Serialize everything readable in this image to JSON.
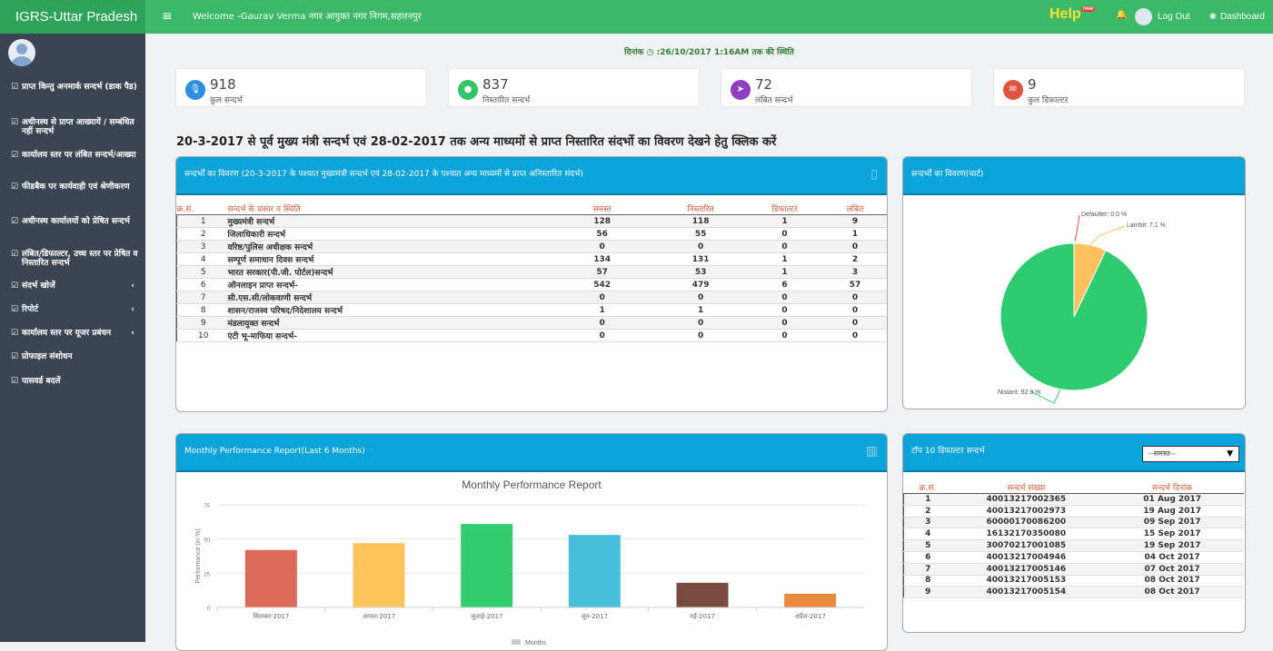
{
  "brand": "IGRS-Uttar Pradesh",
  "header": {
    "menu_icon": "≡",
    "welcome": "Welcome -Gaurav Verma नगर आयुक्त नगर निगम,सहारनपुर",
    "help": "Help",
    "help_badge": "new",
    "logout": "Log Out",
    "dashboard": "Dashboard",
    "icons": {
      "bell": "bell-icon",
      "user": "user-avatar-icon",
      "dashboard": "dashboard-icon"
    }
  },
  "sidebar": {
    "items": [
      {
        "label": "प्राप्त किन्तु अनमार्क सन्दर्भ (डाक पैड)",
        "arrow": ""
      },
      {
        "label": "अधीनस्थ से प्राप्त आख्यायें / सम्बंधित नहीं सन्दर्भ",
        "arrow": "‹"
      },
      {
        "label": "कार्यालय स्तर पर लंबित सन्दर्भ/आख्या",
        "arrow": ""
      },
      {
        "label": "फीडबैक पर कार्यवाही एवं श्रेणीकरण",
        "arrow": ""
      },
      {
        "label": "अधीनस्थ कार्यालयों को प्रेषित सन्दर्भ",
        "arrow": ""
      },
      {
        "label": "लंबित/डिफाल्टर, उच्च स्तर पर प्रेषित व निस्तारित सन्दर्भ",
        "arrow": ""
      },
      {
        "label": "संदर्भ खोजें",
        "arrow": "‹"
      },
      {
        "label": "रिपोर्ट",
        "arrow": "‹"
      },
      {
        "label": "कार्यालय स्तर पर यूजर प्रबंधन",
        "arrow": "‹"
      },
      {
        "label": "प्रोफाइल संशोधन",
        "arrow": ""
      },
      {
        "label": "पासवर्ड बदलें",
        "arrow": ""
      }
    ]
  },
  "date_line": "दिनांक ◷ :26/10/2017 1:16AM तक की स्थिति",
  "stats": [
    {
      "value": "918",
      "label": "कुल सन्दर्भ",
      "color": "#2d8fe0",
      "icon": "microphone-icon",
      "glyph": "🎙"
    },
    {
      "value": "837",
      "label": "निस्तारित सन्दर्भ",
      "color": "#34c46a",
      "icon": "drop-icon",
      "glyph": "●"
    },
    {
      "value": "72",
      "label": "लंबित सन्दर्भ",
      "color": "#8e3fbf",
      "icon": "send-icon",
      "glyph": "➤"
    },
    {
      "value": "9",
      "label": "कुल डिफाल्टर",
      "color": "#e0543d",
      "icon": "envelope-icon",
      "glyph": "✉"
    }
  ],
  "notice": "20-3-2017 से पूर्व मुख्य मंत्री सन्दर्भ एवं 28-02-2017 तक अन्य माध्यमों से प्राप्त निस्तारित संदर्भो का विवरण देखने हेतु क्लिक करें",
  "ref_panel": {
    "title": "सन्दर्भों का विवरण",
    "subtitle": "(20-3-2017 के पश्चात मुख्यमंत्री सन्दर्भ एवं 28-02-2017 के पश्चात अन्य माध्यमों से प्राप्त अनिस्तारित संदर्भ)",
    "columns": [
      "क्र.सं.",
      "सन्दर्भ के प्रकार व स्थिति",
      "समस्त",
      "निस्तारित",
      "डिफाल्टर",
      "लंबित"
    ],
    "rows": [
      [
        "1",
        "मुख्यमंत्री सन्दर्भ",
        "128",
        "118",
        "1",
        "9"
      ],
      [
        "2",
        "जिलाधिकारी सन्दर्भ",
        "56",
        "55",
        "0",
        "1"
      ],
      [
        "3",
        "वरिष्ठ/पुलिस अधीक्षक सन्दर्भ",
        "0",
        "0",
        "0",
        "0"
      ],
      [
        "4",
        "सम्पूर्ण समाधान दिवस सन्दर्भ",
        "134",
        "131",
        "1",
        "2"
      ],
      [
        "5",
        "भारत सरकार(पी.जी. पोर्टल)सन्दर्भ",
        "57",
        "53",
        "1",
        "3"
      ],
      [
        "6",
        "ऑनलाइन प्राप्त सन्दर्भ-",
        "542",
        "479",
        "6",
        "57"
      ],
      [
        "7",
        "सी.एस.सी/लोकवाणी सन्दर्भ",
        "0",
        "0",
        "0",
        "0"
      ],
      [
        "8",
        "शासन/राजस्व परिषद/निदेशालय सन्दर्भ",
        "1",
        "1",
        "0",
        "0"
      ],
      [
        "9",
        "मंडलायुक्त सन्दर्भ",
        "0",
        "0",
        "0",
        "0"
      ],
      [
        "10",
        "एंटी भू-माफिया सन्दर्भ-",
        "0",
        "0",
        "0",
        "0"
      ]
    ]
  },
  "pie_panel": {
    "title": "सन्दर्भों का विवरण(चार्ट)"
  },
  "bar_panel": {
    "title": "Monthly Performance Report(Last 6 Months)"
  },
  "defaulter_panel": {
    "title": "टॉप 10 डिफाल्टर सन्दर्भ",
    "select_value": "--समस्त--",
    "columns": [
      "क्र.सं.",
      "सन्दर्भ संख्या",
      "सन्दर्भ दिनांक"
    ],
    "rows": [
      [
        "1",
        "40013217002365",
        "01 Aug 2017"
      ],
      [
        "2",
        "40013217002973",
        "19 Aug 2017"
      ],
      [
        "3",
        "60000170086200",
        "09 Sep 2017"
      ],
      [
        "4",
        "16132170350080",
        "15 Sep 2017"
      ],
      [
        "5",
        "30070217001085",
        "19 Sep 2017"
      ],
      [
        "6",
        "40013217004946",
        "04 Oct 2017"
      ],
      [
        "7",
        "40013217005146",
        "07 Oct 2017"
      ],
      [
        "8",
        "40013217005153",
        "08 Oct 2017"
      ],
      [
        "9",
        "40013217005154",
        "08 Oct 2017"
      ]
    ]
  },
  "chart_data": [
    {
      "type": "pie",
      "labels": [
        "Nistarit",
        "Lambit",
        "Defaulter"
      ],
      "values": [
        92.9,
        7.1,
        0.0
      ],
      "display_labels": [
        "Nistarit: 92.9 %",
        "Lambit: 7.1 %",
        "Defaulter: 0.0 %"
      ],
      "colors": [
        "#2ecc71",
        "#fcc15d",
        "#e74c3c"
      ]
    },
    {
      "type": "bar",
      "title": "Monthly Performance Report",
      "categories": [
        "सितम्बर-2017",
        "अगस्त-2017",
        "जुलाई-2017",
        "जून-2017",
        "मई-2017",
        "अप्रैल-2017"
      ],
      "values": [
        42,
        47,
        61,
        53,
        18,
        10
      ],
      "colors": [
        "#dd6a56",
        "#fec35d",
        "#33cc6e",
        "#47bfda",
        "#7a4a3e",
        "#e88a3e"
      ],
      "ylabel": "Performance (in %)",
      "xlabel": "Months",
      "ylim": [
        0,
        75
      ],
      "yticks": [
        0,
        25,
        50,
        75
      ],
      "legend": "Months"
    }
  ]
}
